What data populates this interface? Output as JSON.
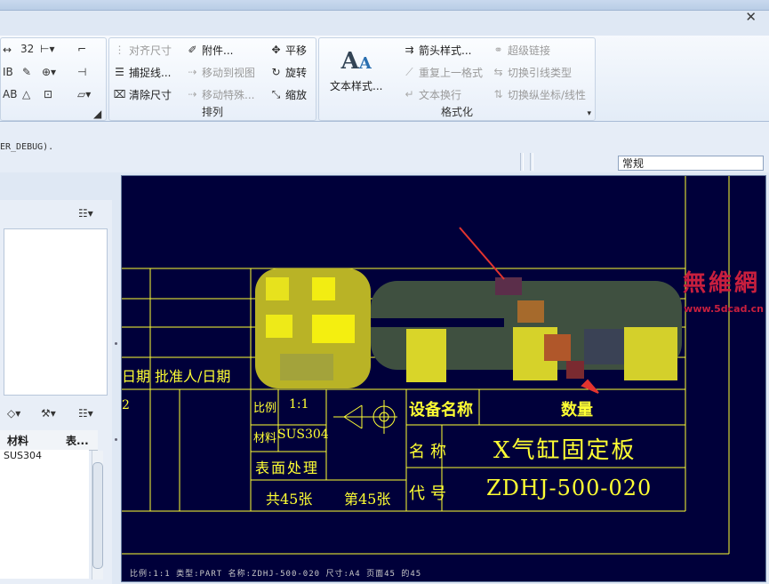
{
  "ribbon": {
    "arrange_group": {
      "label": "排列",
      "align_dim": "对齐尺寸",
      "attach": "附件...",
      "move": "平移",
      "snap_line": "捕捉线...",
      "move_to_view": "移动到视图",
      "rotate": "旋转",
      "clear_dim": "清除尺寸",
      "move_special": "移动特殊...",
      "scale": "缩放"
    },
    "format_group": {
      "label": "格式化",
      "text_style": "文本样式...",
      "arrow_style": "箭头样式...",
      "hyperlink": "超级链接",
      "repeat_format": "重复上一格式",
      "switch_leader": "切换引线类型",
      "text_wrap": "文本换行",
      "switch_ordinate": "切换纵坐标/线性"
    },
    "small_icons": {
      "r1": "32",
      "r2": "IB",
      "r3": "AB"
    }
  },
  "cmdline": {
    "debug_text": "ER_DEBUG)."
  },
  "style_dropdown": {
    "value": "常规"
  },
  "left_panel": {
    "table_headers": [
      "材料",
      "表..."
    ],
    "table_rows": [
      [
        "SUS304",
        ""
      ]
    ]
  },
  "title_block": {
    "row_date_approver": [
      "日期",
      "批准人/日期"
    ],
    "scale_label": "比例",
    "scale_value": "1:1",
    "material_label": "材料",
    "material_value": "SUS304",
    "surface_label": "表面处理",
    "sheets_total": "共45张",
    "sheet_no": "第45张",
    "equipment_label": "设备名称",
    "quantity_label": "数量",
    "name_label": "名称",
    "name_value": "X气缸固定板",
    "code_label": "代号",
    "code_value": "ZDHJ-500-020",
    "left_mark": "2"
  },
  "status_strip": {
    "text": "比例:1:1    类型:PART    名称:ZDHJ-500-020    尺寸:A4    页面45 的45"
  },
  "watermark": {
    "brand": "無維網",
    "url": "www.5dcad.cn"
  },
  "colors": {
    "drawing_bg": "#00003a",
    "line": "#ffff33",
    "watermark": "#c81f3e"
  }
}
